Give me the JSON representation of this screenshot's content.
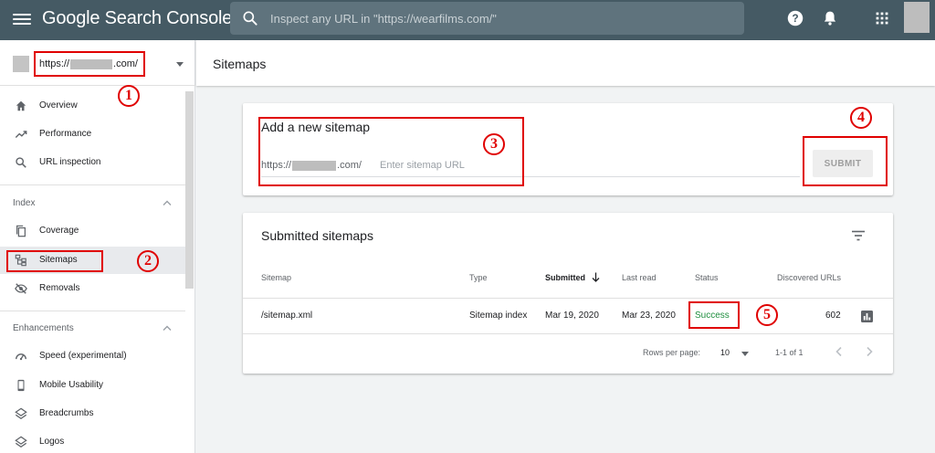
{
  "header": {
    "app_title": "Google Search Console",
    "search_placeholder": "Inspect any URL in \"https://wearfilms.com/\""
  },
  "sidebar": {
    "property_prefix": "https://",
    "property_suffix": ".com/",
    "items": [
      {
        "label": "Overview",
        "icon": "home-icon"
      },
      {
        "label": "Performance",
        "icon": "trending-up-icon"
      },
      {
        "label": "URL inspection",
        "icon": "search-icon"
      },
      {
        "label": "Coverage",
        "icon": "copy-icon"
      },
      {
        "label": "Sitemaps",
        "icon": "sitemap-icon"
      },
      {
        "label": "Removals",
        "icon": "eye-off-icon"
      },
      {
        "label": "Speed (experimental)",
        "icon": "gauge-icon"
      },
      {
        "label": "Mobile Usability",
        "icon": "phone-icon"
      },
      {
        "label": "Breadcrumbs",
        "icon": "layers-icon"
      },
      {
        "label": "Logos",
        "icon": "layers-icon"
      }
    ],
    "sections": {
      "index": "Index",
      "enhancements": "Enhancements"
    },
    "active": "Sitemaps"
  },
  "main": {
    "page_title": "Sitemaps",
    "add_card": {
      "title": "Add a new sitemap",
      "prefix": "https://",
      "suffix": ".com/",
      "input_placeholder": "Enter sitemap URL",
      "submit_label": "SUBMIT"
    },
    "submitted_card": {
      "title": "Submitted sitemaps",
      "columns": [
        "Sitemap",
        "Type",
        "Submitted",
        "Last read",
        "Status",
        "Discovered URLs"
      ],
      "rows": [
        {
          "sitemap": "/sitemap.xml",
          "type": "Sitemap index",
          "submitted": "Mar 19, 2020",
          "last_read": "Mar 23, 2020",
          "status": "Success",
          "discovered": "602"
        }
      ],
      "pagination": {
        "rows_per_page_label": "Rows per page:",
        "rows_per_page": "10",
        "range": "1-1 of 1"
      }
    }
  },
  "annotations": [
    "1",
    "2",
    "3",
    "4",
    "5"
  ],
  "colors": {
    "topbar": "#455a64",
    "search": "#5f737d",
    "annotation": "#e00000",
    "success": "#1e8e3e"
  }
}
